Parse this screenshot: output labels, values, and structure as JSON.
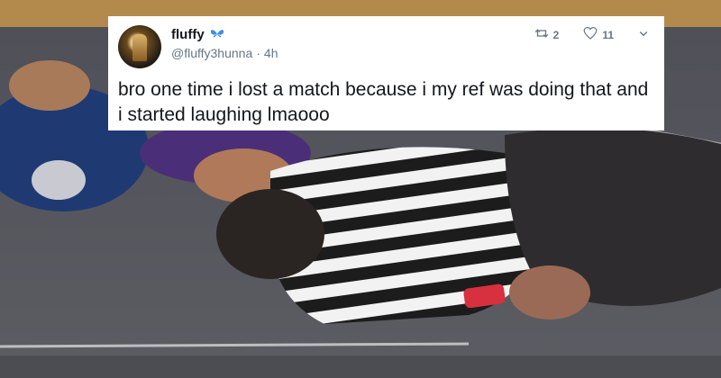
{
  "tweet": {
    "display_name": "fluffy",
    "handle": "@fluffy3hunna",
    "separator": "·",
    "time": "4h",
    "retweet_count": "2",
    "like_count": "11",
    "text": "bro one time i lost a match because i my ref was doing that and i started laughing lmaooo"
  },
  "icons": {
    "verified_like": "butterfly-icon",
    "retweet": "retweet-icon",
    "like": "heart-icon",
    "menu": "chevron-down-icon"
  },
  "colors": {
    "card_bg": "#ffffff",
    "text": "#14171a",
    "muted": "#657786",
    "butterfly": "#3b8ee8"
  }
}
